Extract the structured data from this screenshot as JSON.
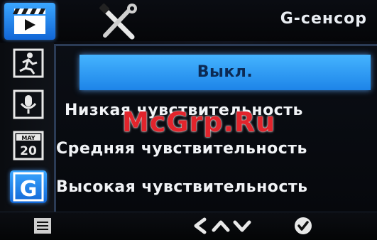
{
  "header": {
    "title": "G-сенсор"
  },
  "tabs": [
    {
      "icon": "video-clapper-icon"
    },
    {
      "icon": "wrench-screwdriver-icon"
    }
  ],
  "sidebar": {
    "items": [
      {
        "icon": "motion-detection-icon"
      },
      {
        "icon": "microphone-icon"
      },
      {
        "icon": "calendar-date-icon",
        "date_month": "MAY",
        "date_day": "20"
      },
      {
        "icon": "g-sensor-icon",
        "letter": "G"
      }
    ]
  },
  "menu": {
    "options": [
      {
        "label": "Выкл.",
        "selected": true
      },
      {
        "label": "Низкая чувствительность",
        "selected": false
      },
      {
        "label": "Средняя чувствительность",
        "selected": false
      },
      {
        "label": "Высокая чувствительность",
        "selected": false
      }
    ]
  },
  "bottombar": {
    "buttons": [
      {
        "icon": "menu-list-icon"
      },
      {
        "icon": "back-chevron-icon"
      },
      {
        "icon": "up-chevron-icon"
      },
      {
        "icon": "down-chevron-icon"
      },
      {
        "icon": "confirm-check-icon"
      }
    ]
  },
  "watermark": {
    "text": "McGrp.Ru"
  },
  "colors": {
    "accent": "#2a8cf0",
    "watermark": "#e2242c",
    "text": "#f1f3f6"
  }
}
